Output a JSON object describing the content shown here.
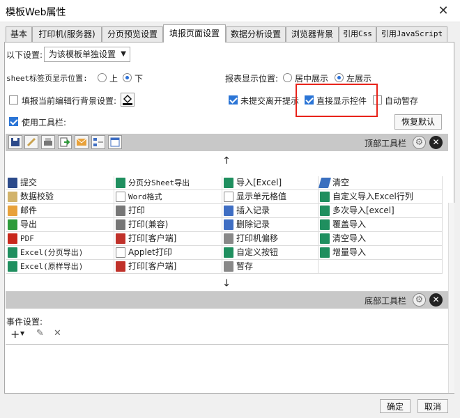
{
  "window": {
    "title": "模板Web属性",
    "close_glyph": "✕"
  },
  "tabs": [
    {
      "label": "基本"
    },
    {
      "label": "打印机(服务器)"
    },
    {
      "label": "分页预览设置"
    },
    {
      "label": "填报页面设置",
      "active": true
    },
    {
      "label": "数据分析设置"
    },
    {
      "label": "浏览器背景"
    },
    {
      "label": "引用Css"
    },
    {
      "label": "引用JavaScript"
    }
  ],
  "settings": {
    "scope_label": "以下设置:",
    "scope_value": "为该模板单独设置",
    "sheet_tab_label": "sheet标签页显示位置:",
    "sheet_tab_options": [
      "上",
      "下"
    ],
    "sheet_tab_selected": "下",
    "report_pos_label": "报表显示位置:",
    "report_pos_options": [
      "居中展示",
      "左展示"
    ],
    "report_pos_selected": "左展示",
    "fill_bg_label": "填报当前编辑行背景设置:",
    "unsubmitted_prompt_label": "未提交离开提示",
    "show_controls_label": "直接显示控件",
    "auto_save_label": "自动暂存",
    "use_toolbar_label": "使用工具栏:",
    "restore_default": "恢复默认",
    "top_toolbar_label": "顶部工具栏",
    "bottom_toolbar_label": "底部工具栏",
    "event_label": "事件设置:"
  },
  "grid": {
    "col1": [
      "提交",
      "数据校验",
      "邮件",
      "导出",
      "PDF",
      "Excel(分页导出)",
      "Excel(原样导出)"
    ],
    "col2": [
      "分页分Sheet导出",
      "Word格式",
      "打印",
      "打印(兼容)",
      "打印[客户端]",
      "Applet打印",
      "打印[客户端]"
    ],
    "col3": [
      "导入[Excel]",
      "显示单元格值",
      "插入记录",
      "删除记录",
      "打印机偏移",
      "自定义按钮",
      "暂存"
    ],
    "col4": [
      "清空",
      "自定义导入Excel行列",
      "多次导入[excel]",
      "覆盖导入",
      "清空导入",
      "增量导入",
      ""
    ]
  },
  "arrows": {
    "up": "↑",
    "down": "↓"
  },
  "footer": {
    "ok": "确定",
    "cancel": "取消"
  },
  "colors": {
    "highlight": "#e8231a",
    "accent": "#2b75d6",
    "toolbar_band": "#c8c8c8"
  }
}
